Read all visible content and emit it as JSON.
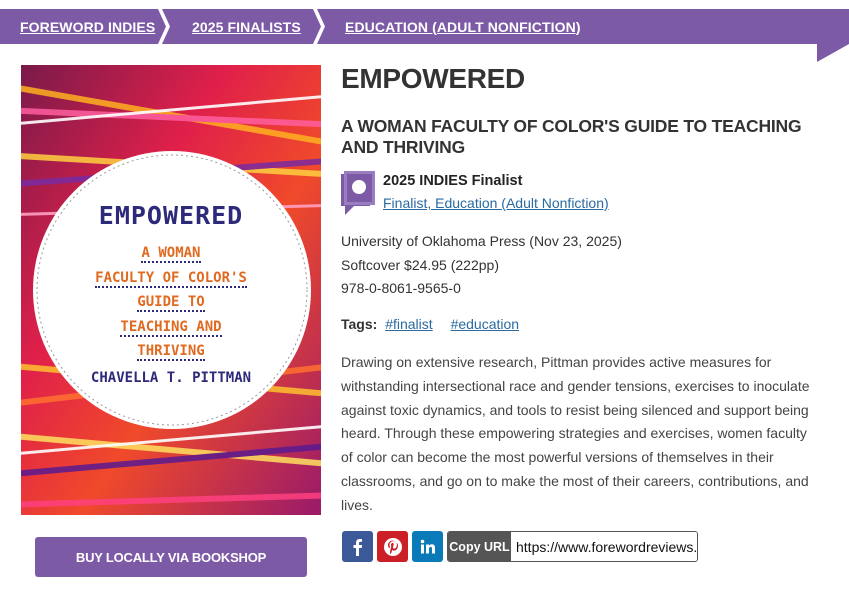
{
  "breadcrumb": {
    "items": [
      {
        "label": "FOREWORD INDIES"
      },
      {
        "label": "2025 FINALISTS"
      },
      {
        "label": "EDUCATION (ADULT NONFICTION)"
      }
    ]
  },
  "book": {
    "title": "EMPOWERED",
    "subtitle": "A WOMAN FACULTY OF COLOR'S GUIDE TO TEACHING AND THRIVING",
    "cover": {
      "title": "EMPOWERED",
      "subtitle_lines": [
        "A WOMAN",
        "FACULTY OF COLOR'S",
        "GUIDE TO",
        "TEACHING AND",
        "THRIVING"
      ],
      "author": "CHAVELLA T. PITTMAN"
    },
    "award": {
      "title": "2025 INDIES Finalist",
      "link": "Finalist, Education (Adult Nonfiction)"
    },
    "publisher_line": "University of Oklahoma Press (Nov 23, 2025)",
    "format_line": "Softcover $24.95 (222pp)",
    "isbn": "978-0-8061-9565-0",
    "tags_label": "Tags:",
    "tags": [
      "#finalist",
      "#education"
    ],
    "description": "Drawing on extensive research, Pittman provides active measures for withstanding intersectional race and gender tensions, exercises to inoculate against toxic dynamics, and tools to resist being silenced and support being heard. Through these empowering strategies and exercises, women faculty of color can become the most powerful versions of themselves in their classrooms, and go on to make the most of their careers, contributions, and lives."
  },
  "buy_button": {
    "label": "BUY LOCALLY VIA BOOKSHOP"
  },
  "share": {
    "icons": [
      "facebook-icon",
      "pinterest-icon",
      "linkedin-icon"
    ],
    "copy_label": "Copy URL",
    "url_value": "https://www.forewordreviews.com/books/reviews/empowered/"
  },
  "colors": {
    "brand_purple": "#7d5aa6",
    "link_blue": "#2a6aa0",
    "facebook": "#3b5998",
    "pinterest": "#cb2027",
    "linkedin": "#0a7bb8"
  }
}
